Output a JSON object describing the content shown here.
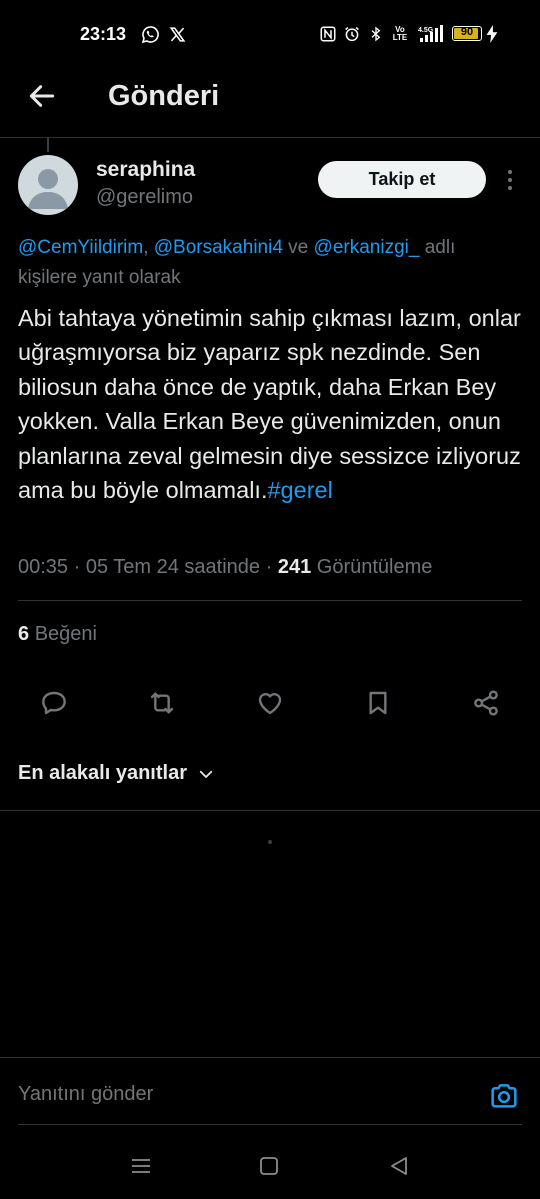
{
  "status_bar": {
    "time": "23:13",
    "battery": "90",
    "icons": [
      "whatsapp-icon",
      "x-icon",
      "nfc-icon",
      "alarm-icon",
      "bluetooth-icon",
      "volte-icon",
      "signal-icon",
      "battery-icon",
      "charging-icon"
    ]
  },
  "header": {
    "title": "Gönderi"
  },
  "author": {
    "name": "seraphina",
    "handle": "@gerelimo",
    "follow_label": "Takip et"
  },
  "reply_to": {
    "mentions": [
      "@CemYiildirim",
      "@Borsakahini4",
      "@erkanizgi_"
    ],
    "sep1": ", ",
    "conj": " ve ",
    "suffix_1": " adlı",
    "suffix_2": "kişilere yanıt olarak"
  },
  "post": {
    "text": "Abi tahtaya yönetimin sahip çıkması lazım, onlar uğraşmıyorsa biz yaparız spk nezdinde. Sen biliosun daha önce de yaptık, daha Erkan Bey yokken. Valla Erkan Beye güvenimizden, onun planlarına zeval gelmesin diye sessizce izliyoruz ama bu böyle olmamalı.",
    "hashtag": "#gerel",
    "time": "00:35",
    "date": "05 Tem 24 saatinde",
    "sep": " · ",
    "views": "241",
    "views_label": "Görüntüleme"
  },
  "stats": {
    "likes": "6",
    "likes_label": "Beğeni"
  },
  "actions": [
    "reply-icon",
    "repost-icon",
    "like-icon",
    "bookmark-icon",
    "share-icon"
  ],
  "replies": {
    "sort_label": "En alakalı yanıtlar"
  },
  "composer": {
    "placeholder": "Yanıtını gönder"
  },
  "colors": {
    "accent": "#1d9bf0",
    "background": "#000000",
    "text": "#e7e9ea",
    "muted": "#71767b",
    "battery": "#d9b21a"
  }
}
